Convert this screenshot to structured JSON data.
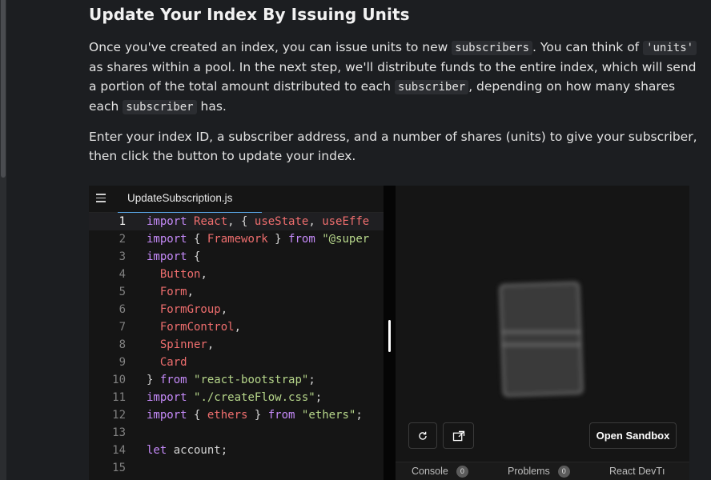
{
  "article": {
    "heading": "Update Your Index By Issuing Units",
    "p1": {
      "t1": "Once you've created an index, you can issue units to new ",
      "c1": "subscribers",
      "t2": ". You can think of ",
      "c2": "'units'",
      "t3": " as shares within a pool. In the next step, we'll distribute funds to the entire index, which will send a portion of the total amount distributed to each ",
      "c3": "subscriber",
      "t4": ", depending on how many shares each ",
      "c4": "subscriber",
      "t5": " has."
    },
    "p2": "Enter your index ID, a subscriber address, and a number of shares (units) to give your subscriber, then click the button to update your index."
  },
  "editor": {
    "tab_label": "UpdateSubscription.js",
    "active_line": 1,
    "lines": [
      {
        "n": "1",
        "tokens": [
          {
            "c": "kw",
            "t": "import "
          },
          {
            "c": "id",
            "t": "React"
          },
          {
            "c": "",
            "t": ", { "
          },
          {
            "c": "id",
            "t": "useState"
          },
          {
            "c": "",
            "t": ", "
          },
          {
            "c": "id",
            "t": "useEffe"
          }
        ]
      },
      {
        "n": "2",
        "tokens": [
          {
            "c": "kw",
            "t": "import "
          },
          {
            "c": "",
            "t": "{ "
          },
          {
            "c": "id",
            "t": "Framework"
          },
          {
            "c": "",
            "t": " } "
          },
          {
            "c": "kw",
            "t": "from "
          },
          {
            "c": "st",
            "t": "\"@super"
          }
        ]
      },
      {
        "n": "3",
        "tokens": [
          {
            "c": "kw",
            "t": "import "
          },
          {
            "c": "",
            "t": "{"
          }
        ]
      },
      {
        "n": "4",
        "tokens": [
          {
            "c": "",
            "t": "  "
          },
          {
            "c": "id",
            "t": "Button"
          },
          {
            "c": "",
            "t": ","
          }
        ]
      },
      {
        "n": "5",
        "tokens": [
          {
            "c": "",
            "t": "  "
          },
          {
            "c": "id",
            "t": "Form"
          },
          {
            "c": "",
            "t": ","
          }
        ]
      },
      {
        "n": "6",
        "tokens": [
          {
            "c": "",
            "t": "  "
          },
          {
            "c": "id",
            "t": "FormGroup"
          },
          {
            "c": "",
            "t": ","
          }
        ]
      },
      {
        "n": "7",
        "tokens": [
          {
            "c": "",
            "t": "  "
          },
          {
            "c": "id",
            "t": "FormControl"
          },
          {
            "c": "",
            "t": ","
          }
        ]
      },
      {
        "n": "8",
        "tokens": [
          {
            "c": "",
            "t": "  "
          },
          {
            "c": "id",
            "t": "Spinner"
          },
          {
            "c": "",
            "t": ","
          }
        ]
      },
      {
        "n": "9",
        "tokens": [
          {
            "c": "",
            "t": "  "
          },
          {
            "c": "id",
            "t": "Card"
          }
        ]
      },
      {
        "n": "10",
        "tokens": [
          {
            "c": "",
            "t": "} "
          },
          {
            "c": "kw",
            "t": "from "
          },
          {
            "c": "st",
            "t": "\"react-bootstrap\""
          },
          {
            "c": "",
            "t": ";"
          }
        ]
      },
      {
        "n": "11",
        "tokens": [
          {
            "c": "kw",
            "t": "import "
          },
          {
            "c": "st",
            "t": "\"./createFlow.css\""
          },
          {
            "c": "",
            "t": ";"
          }
        ]
      },
      {
        "n": "12",
        "tokens": [
          {
            "c": "kw",
            "t": "import "
          },
          {
            "c": "",
            "t": "{ "
          },
          {
            "c": "id",
            "t": "ethers"
          },
          {
            "c": "",
            "t": " } "
          },
          {
            "c": "kw",
            "t": "from "
          },
          {
            "c": "st",
            "t": "\"ethers\""
          },
          {
            "c": "",
            "t": ";"
          }
        ]
      },
      {
        "n": "13",
        "tokens": []
      },
      {
        "n": "14",
        "tokens": [
          {
            "c": "kw",
            "t": "let "
          },
          {
            "c": "",
            "t": "account;"
          }
        ]
      },
      {
        "n": "15",
        "tokens": []
      }
    ]
  },
  "preview": {
    "open_sandbox_label": "Open Sandbox",
    "refresh_icon": "refresh-icon",
    "external_icon": "external-link-icon",
    "bottom_tabs": [
      {
        "label": "Console",
        "badge": "0"
      },
      {
        "label": "Problems",
        "badge": "0"
      },
      {
        "label": "React DevTı"
      }
    ]
  },
  "colors": {
    "background": "#1c1e21",
    "keyword": "#c58af9",
    "identifier": "#ef6e6e",
    "string": "#b6d68a",
    "tab_underline": "#5aa7e8"
  }
}
